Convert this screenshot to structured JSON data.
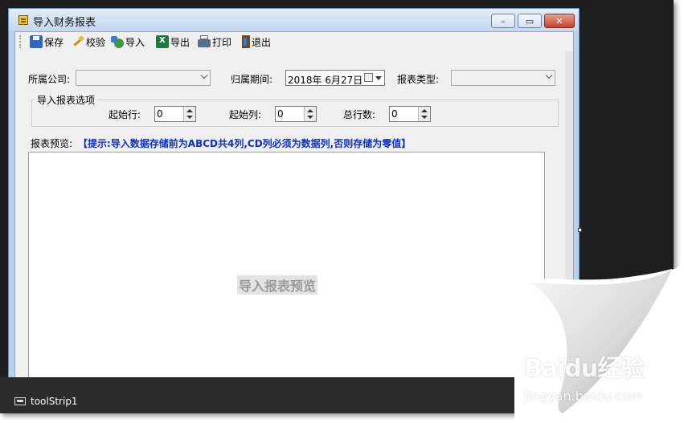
{
  "window": {
    "title": "导入财务报表",
    "controls": {
      "minimize": "–",
      "maximize": "▭",
      "close": "✕"
    }
  },
  "toolbar": {
    "items": [
      {
        "label": "保存",
        "icon": "save-icon"
      },
      {
        "label": "校验",
        "icon": "validate-icon"
      },
      {
        "label": "导入",
        "icon": "import-icon"
      },
      {
        "label": "导出",
        "icon": "excel-export-icon"
      },
      {
        "label": "打印",
        "icon": "print-icon"
      },
      {
        "label": "退出",
        "icon": "exit-icon"
      }
    ]
  },
  "filters": {
    "company_label": "所属公司:",
    "company_value": "",
    "period_label": "归属期间:",
    "period_value": "2018年  6月27日",
    "report_type_label": "报表类型:",
    "report_type_value": ""
  },
  "import_options": {
    "group_title": "导入报表选项",
    "start_row_label": "起始行:",
    "start_row_value": "0",
    "start_col_label": "起始列:",
    "start_col_value": "0",
    "total_rows_label": "总行数:",
    "total_rows_value": "0"
  },
  "preview": {
    "label": "报表预览:",
    "hint": "【提示:导入数据存储前为ABCD共4列,CD列必须为数据列,否则存储为零值】",
    "placeholder": "导入报表预览"
  },
  "tray": {
    "component": "toolStrip1"
  },
  "watermark": {
    "brand": "Baidu经验",
    "site": "jingyan.baidu.com"
  },
  "colors": {
    "hint": "#0a2fd0",
    "title_bar": "#c3d7ef",
    "designer_bg": "#1e1e1e"
  }
}
